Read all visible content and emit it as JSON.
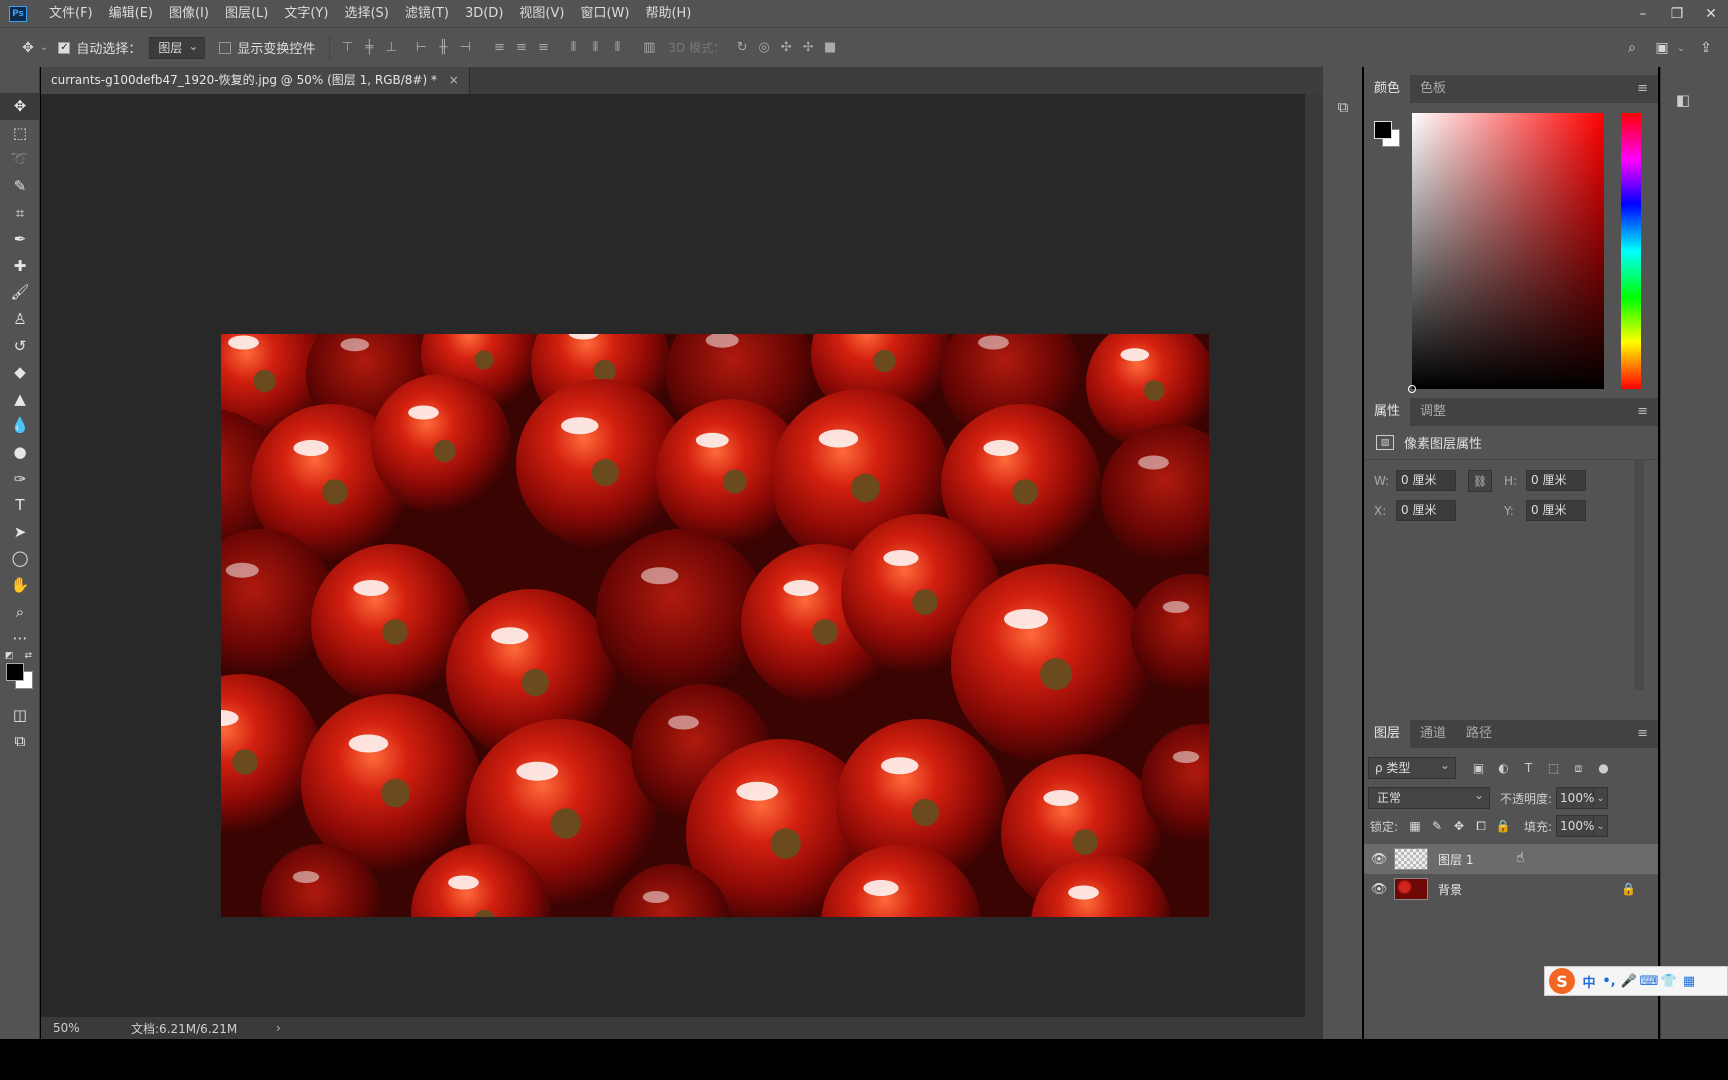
{
  "app": {
    "logo_text": "Ps"
  },
  "menu": [
    "文件(F)",
    "编辑(E)",
    "图像(I)",
    "图层(L)",
    "文字(Y)",
    "选择(S)",
    "滤镜(T)",
    "3D(D)",
    "视图(V)",
    "窗口(W)",
    "帮助(H)"
  ],
  "window_controls": {
    "minimize": "–",
    "restore": "❐",
    "close": "✕"
  },
  "options": {
    "auto_select_label": "自动选择：",
    "auto_select_checked": true,
    "target_value": "图层",
    "show_transform_label": "显示变换控件",
    "show_transform_checked": false,
    "mode3d_label": "3D 模式："
  },
  "document": {
    "tab_title": "currants-g100defb47_1920-恢复的.jpg @ 50% (图层 1, RGB/8#) *",
    "close": "×"
  },
  "status": {
    "zoom": "50%",
    "doc_size": "文档:6.21M/6.21M",
    "arrow": "›"
  },
  "color_panel": {
    "tabs": [
      "颜色",
      "色板"
    ],
    "active_tab": "颜色",
    "foreground": "#000000",
    "background": "#ffffff",
    "hue": "#ff0000"
  },
  "properties_panel": {
    "tabs": [
      "属性",
      "调整"
    ],
    "type_label": "像素图层属性",
    "w_label": "W:",
    "w_value": "0 厘米",
    "h_label": "H:",
    "h_value": "0 厘米",
    "x_label": "X:",
    "x_value": "0 厘米",
    "y_label": "Y:",
    "y_value": "0 厘米"
  },
  "layers_panel": {
    "tabs": [
      "图层",
      "通道",
      "路径"
    ],
    "filter_value": "ρ 类型",
    "blend_mode": "正常",
    "opacity_label": "不透明度:",
    "opacity_value": "100%",
    "lock_label": "锁定:",
    "fill_label": "填充:",
    "fill_value": "100%",
    "layers": [
      {
        "name": "图层 1",
        "selected": true,
        "visible": true,
        "locked": false
      },
      {
        "name": "背景",
        "selected": false,
        "visible": true,
        "locked": true
      }
    ]
  },
  "ime": {
    "logo": "S",
    "items": [
      "中",
      "•,",
      "🎤",
      "⌨",
      "👕",
      "▦"
    ]
  }
}
